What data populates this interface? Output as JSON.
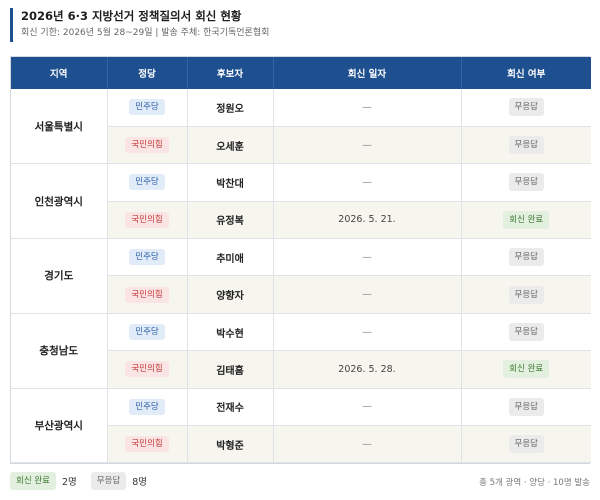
{
  "header": {
    "title": "2026년 6·3 지방선거 정책질의서 회신 현황",
    "subtitle": "회신 기한: 2026년 5월 28~29일  |  발송 주체: 한국기독언론협회"
  },
  "columns": [
    "지역",
    "정당",
    "후보자",
    "회신 일자",
    "회신 여부"
  ],
  "regions": [
    {
      "name": "서울특별시",
      "rows": [
        {
          "party": "민주당",
          "party_type": "dem",
          "candidate": "정원오",
          "date": "—",
          "status": "무응답",
          "status_type": "none"
        },
        {
          "party": "국민의힘",
          "party_type": "ppp",
          "candidate": "오세훈",
          "date": "—",
          "status": "무응답",
          "status_type": "none"
        }
      ]
    },
    {
      "name": "인천광역시",
      "rows": [
        {
          "party": "민주당",
          "party_type": "dem",
          "candidate": "박찬대",
          "date": "—",
          "status": "무응답",
          "status_type": "none"
        },
        {
          "party": "국민의힘",
          "party_type": "ppp",
          "candidate": "유정복",
          "date": "2026. 5. 21.",
          "status": "회신 완료",
          "status_type": "done"
        }
      ]
    },
    {
      "name": "경기도",
      "rows": [
        {
          "party": "민주당",
          "party_type": "dem",
          "candidate": "추미애",
          "date": "—",
          "status": "무응답",
          "status_type": "none"
        },
        {
          "party": "국민의힘",
          "party_type": "ppp",
          "candidate": "양향자",
          "date": "—",
          "status": "무응답",
          "status_type": "none"
        }
      ]
    },
    {
      "name": "충청남도",
      "rows": [
        {
          "party": "민주당",
          "party_type": "dem",
          "candidate": "박수현",
          "date": "—",
          "status": "무응답",
          "status_type": "none"
        },
        {
          "party": "국민의힘",
          "party_type": "ppp",
          "candidate": "김태흠",
          "date": "2026. 5. 28.",
          "status": "회신 완료",
          "status_type": "done"
        }
      ]
    },
    {
      "name": "부산광역시",
      "rows": [
        {
          "party": "민주당",
          "party_type": "dem",
          "candidate": "전재수",
          "date": "—",
          "status": "무응답",
          "status_type": "none"
        },
        {
          "party": "국민의힘",
          "party_type": "ppp",
          "candidate": "박형준",
          "date": "—",
          "status": "무응답",
          "status_type": "none"
        }
      ]
    }
  ],
  "footer": {
    "legend": [
      {
        "label": "회신 완료",
        "type": "done",
        "count": "2명"
      },
      {
        "label": "무응답",
        "type": "none",
        "count": "8명"
      }
    ],
    "summary": "총 5개 광역 · 양당 · 10명 발송"
  },
  "colors": {
    "header_bg": "#1e4f8f",
    "accent_bar": "#1e4f8f",
    "dem_badge": "#2a5ea8",
    "ppp_badge": "#c43a3a",
    "done_badge": "#3d7a32",
    "none_badge": "#666666",
    "alt_row_bg": "#f6f5ee"
  }
}
